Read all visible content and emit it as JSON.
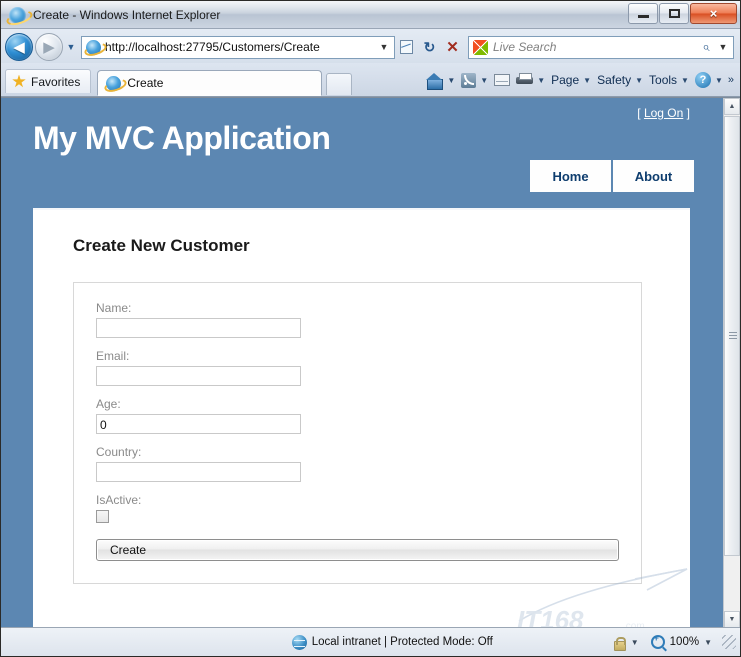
{
  "window": {
    "title": "Create - Windows Internet Explorer",
    "icon": "ie-icon",
    "minimize_label": "Minimize",
    "restore_label": "Restore",
    "close_label": "×"
  },
  "navigation": {
    "back_label": "◀",
    "forward_label": "▶",
    "recent_caret": "▼",
    "url": "http://localhost:27795/Customers/Create",
    "url_caret": "▼",
    "compat_view": "compatibility-view-icon",
    "refresh_label": "↻",
    "stop_label": "✕"
  },
  "search": {
    "placeholder": "Live Search",
    "provider_icon": "windows-live-icon",
    "magnifier": "⌕",
    "caret": "▼"
  },
  "tabs": {
    "favorites_label": "Favorites",
    "open_tab_label": "Create",
    "new_tab_label": ""
  },
  "commandbar": {
    "items": [
      {
        "name": "home",
        "label": "",
        "icon": "home-icon",
        "caret": "▼"
      },
      {
        "name": "feeds",
        "label": "",
        "icon": "rss-icon",
        "caret": "▼"
      },
      {
        "name": "mail",
        "label": "",
        "icon": "mail-icon",
        "caret": ""
      },
      {
        "name": "print",
        "label": "",
        "icon": "printer-icon",
        "caret": "▼"
      },
      {
        "name": "page",
        "label": "Page",
        "icon": "",
        "caret": "▼"
      },
      {
        "name": "safety",
        "label": "Safety",
        "icon": "",
        "caret": "▼"
      },
      {
        "name": "tools",
        "label": "Tools",
        "icon": "",
        "caret": "▼"
      },
      {
        "name": "help",
        "label": "",
        "icon": "help-icon",
        "caret": "▼"
      }
    ],
    "overflow": "»"
  },
  "page": {
    "app_title": "My MVC Application",
    "logon_prefix": "[",
    "logon_link": "Log On",
    "logon_suffix": "]",
    "menu": [
      {
        "label": "Home"
      },
      {
        "label": "About"
      }
    ],
    "heading": "Create New Customer",
    "fields": [
      {
        "label": "Name:",
        "value": "",
        "type": "text"
      },
      {
        "label": "Email:",
        "value": "",
        "type": "text"
      },
      {
        "label": "Age:",
        "value": "0",
        "type": "text"
      },
      {
        "label": "Country:",
        "value": "",
        "type": "text"
      },
      {
        "label": "IsActive:",
        "value": "",
        "type": "checkbox",
        "checked": false
      }
    ],
    "submit_label": "Create",
    "colors": {
      "page_background": "#5c87b2",
      "content_background": "#ffffff",
      "menu_text": "#0e3d6e",
      "label_text": "#8a8a8a"
    }
  },
  "scrollbar": {
    "up_arrow": "▲",
    "down_arrow": "▼"
  },
  "statusbar": {
    "zone_text": "Local intranet | Protected Mode: Off",
    "zone_icon": "globe-icon",
    "privacy_icon": "privacy-lock-icon",
    "privacy_caret": "▼",
    "zoom_level": "100%",
    "zoom_caret": "▼"
  }
}
